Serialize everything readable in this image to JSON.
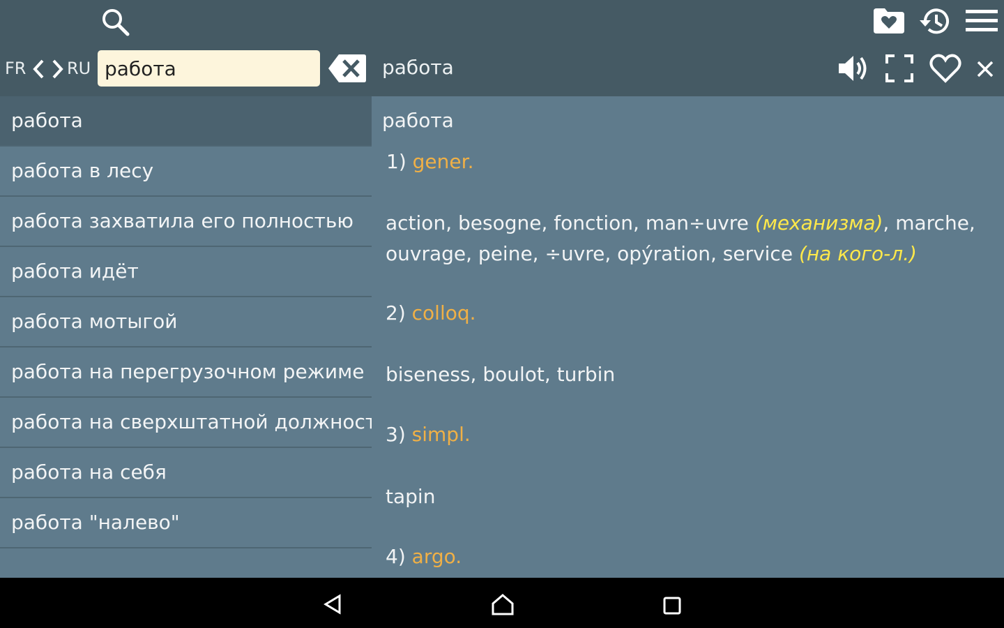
{
  "nav": {
    "lang_from": "FR",
    "lang_to": "RU"
  },
  "search": {
    "value": "работа"
  },
  "header": {
    "word": "работа"
  },
  "list": {
    "items": [
      "работа",
      "работа в лесу",
      "работа захватила его полностью",
      "работа идёт",
      "работа мотыгой",
      "работа на перегрузочном режиме",
      "работа на сверхштатной должност",
      "работа на себя",
      "работа \"налево\""
    ]
  },
  "article": {
    "title": "работа",
    "senses": [
      {
        "num": "1)",
        "label": "gener.",
        "text_a": "action, besogne, fonction, man÷uvre ",
        "note_a": "(механизма)",
        "text_b": ", marche, ouvrage, peine, ÷uvre, opýration, service ",
        "note_b": "(на кого-л.)"
      },
      {
        "num": "2)",
        "label": "colloq.",
        "text": "biseness, boulot, turbin"
      },
      {
        "num": "3)",
        "label": "simpl.",
        "text": "tapin"
      },
      {
        "num": "4)",
        "label": "argo."
      }
    ]
  },
  "colors": {
    "bar": "#455a64",
    "panel": "#5f7b8c",
    "label": "#f0b046",
    "note": "#ffe94a"
  },
  "icons": [
    "search-icon",
    "folder-heart-icon",
    "history-icon",
    "menu-icon",
    "chevron-left-icon",
    "chevron-right-icon",
    "clear-icon",
    "speaker-icon",
    "fullscreen-icon",
    "heart-icon",
    "close-icon",
    "back-icon",
    "home-icon",
    "recents-icon"
  ]
}
